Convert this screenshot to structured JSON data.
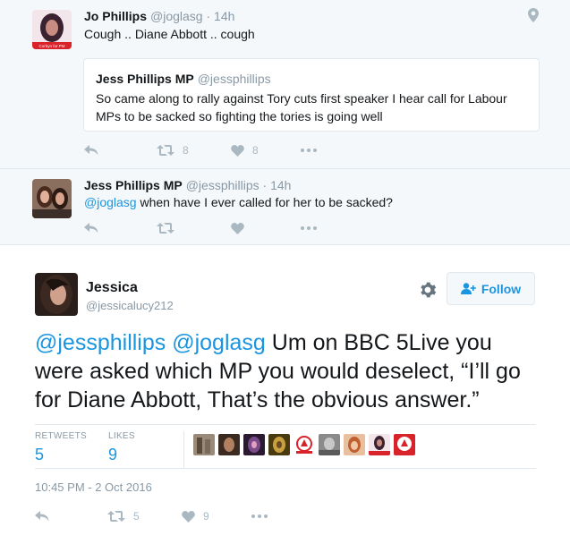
{
  "context": {
    "tweet1": {
      "name": "Jo Phillips",
      "handle": "@joglasg",
      "time": "· 14h",
      "text": "Cough .. Diane Abbott .. cough",
      "avatar_caption": "Corbyn for PM",
      "quoted": {
        "name": "Jess Phillips MP",
        "handle": "@jessphillips",
        "text": "So came along to rally against Tory cuts first speaker I hear call for Labour MPs to be sacked so fighting the tories is going well"
      },
      "retweets": "8",
      "likes": "8"
    },
    "tweet2": {
      "name": "Jess Phillips MP",
      "handle": "@jessphillips",
      "time": "· 14h",
      "mention": "@joglasg",
      "text": " when have I ever called for her to be sacked?"
    }
  },
  "main": {
    "name": "Jessica",
    "handle": "@jessicalucy212",
    "follow_label": "Follow",
    "mention1": "@jessphillips",
    "mention2": "@joglasg",
    "text": " Um on BBC 5Live you were asked which MP you would deselect, “I’ll go for Diane Abbott, That’s the obvious answer.”",
    "stats": {
      "retweets_label": "RETWEETS",
      "retweets": "5",
      "likes_label": "LIKES",
      "likes": "9"
    },
    "timestamp": "10:45 PM - 2 Oct 2016",
    "action_retweets": "5",
    "action_likes": "9"
  },
  "colors": {
    "accent": "#1b95e0",
    "muted": "#8899a6",
    "icon": "#aab8c2",
    "context_bg": "#f5f8fa",
    "border": "#e1e8ed"
  },
  "icons": [
    "reply-icon",
    "retweet-icon",
    "like-icon",
    "more-icon",
    "geo-pin-icon",
    "gear-icon",
    "follow-person-icon"
  ]
}
